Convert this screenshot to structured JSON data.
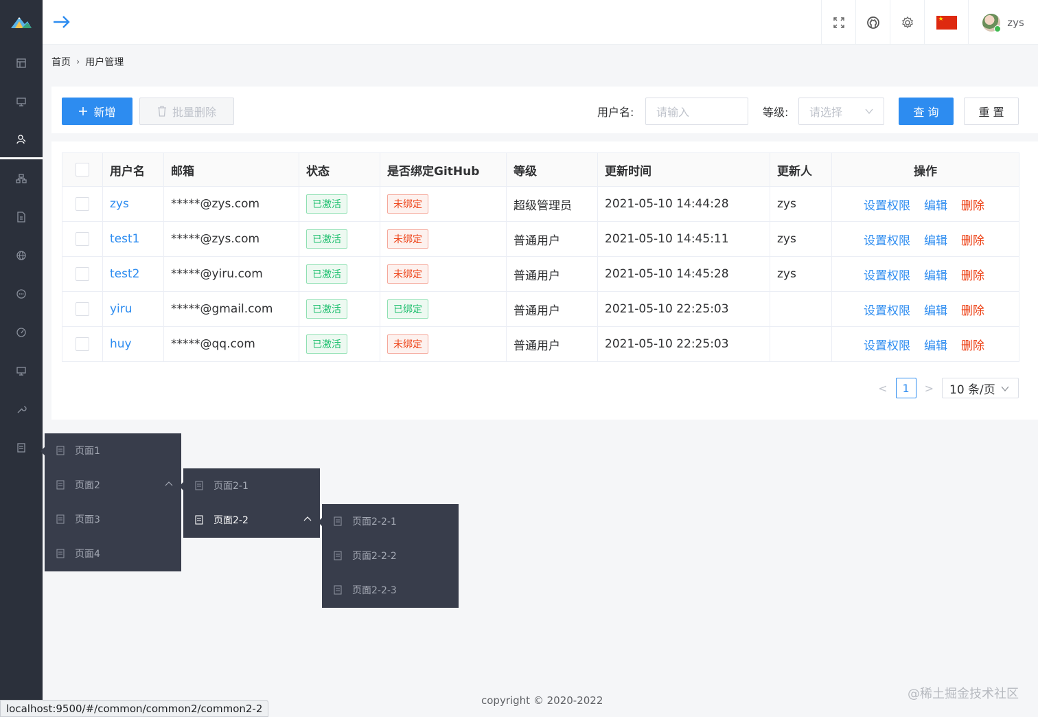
{
  "header": {
    "user_name": "zys",
    "icons": [
      "arrow-right-icon",
      "fullscreen-icon",
      "github-icon",
      "gear-icon",
      "china-flag",
      "avatar"
    ]
  },
  "breadcrumb": {
    "home": "首页",
    "separator": "›",
    "current": "用户管理"
  },
  "toolbar": {
    "add_label": "新增",
    "batch_delete_label": "批量删除",
    "username_label": "用户名:",
    "username_placeholder": "请输入",
    "level_label": "等级:",
    "level_placeholder": "请选择",
    "query_label": "查 询",
    "reset_label": "重 置"
  },
  "table": {
    "headers": [
      "用户名",
      "邮箱",
      "状态",
      "是否绑定GitHub",
      "等级",
      "更新时间",
      "更新人",
      "操作"
    ],
    "rows": [
      {
        "username": "zys",
        "email": "*****@zys.com",
        "status": "已激活",
        "github": "未绑定",
        "github_bound": false,
        "level": "超级管理员",
        "updated": "2021-05-10 14:44:28",
        "updater": "zys"
      },
      {
        "username": "test1",
        "email": "*****@zys.com",
        "status": "已激活",
        "github": "未绑定",
        "github_bound": false,
        "level": "普通用户",
        "updated": "2021-05-10 14:45:11",
        "updater": "zys"
      },
      {
        "username": "test2",
        "email": "*****@yiru.com",
        "status": "已激活",
        "github": "未绑定",
        "github_bound": false,
        "level": "普通用户",
        "updated": "2021-05-10 14:45:28",
        "updater": "zys"
      },
      {
        "username": "yiru",
        "email": "*****@gmail.com",
        "status": "已激活",
        "github": "已绑定",
        "github_bound": true,
        "level": "普通用户",
        "updated": "2021-05-10 22:25:03",
        "updater": ""
      },
      {
        "username": "huy",
        "email": "*****@qq.com",
        "status": "已激活",
        "github": "未绑定",
        "github_bound": false,
        "level": "普通用户",
        "updated": "2021-05-10 22:25:03",
        "updater": ""
      }
    ],
    "actions": {
      "permission": "设置权限",
      "edit": "编辑",
      "delete": "删除"
    }
  },
  "pagination": {
    "current_page": "1",
    "page_size": "10 条/页"
  },
  "menus": {
    "level1": [
      "页面1",
      "页面2",
      "页面3",
      "页面4"
    ],
    "level2": [
      "页面2-1",
      "页面2-2"
    ],
    "level3": [
      "页面2-2-1",
      "页面2-2-2",
      "页面2-2-3"
    ]
  },
  "footer": {
    "copyright": "copyright © 2020-2022",
    "watermark": "@稀土掘金技术社区"
  },
  "statusbar": {
    "url": "localhost:9500/#/common/common2/common2-2"
  },
  "colors": {
    "sidebar": "#2b303b",
    "primary": "#2d8cf0",
    "danger": "#ed4014",
    "success": "#19be6b",
    "menu_bg": "#383d4b"
  }
}
